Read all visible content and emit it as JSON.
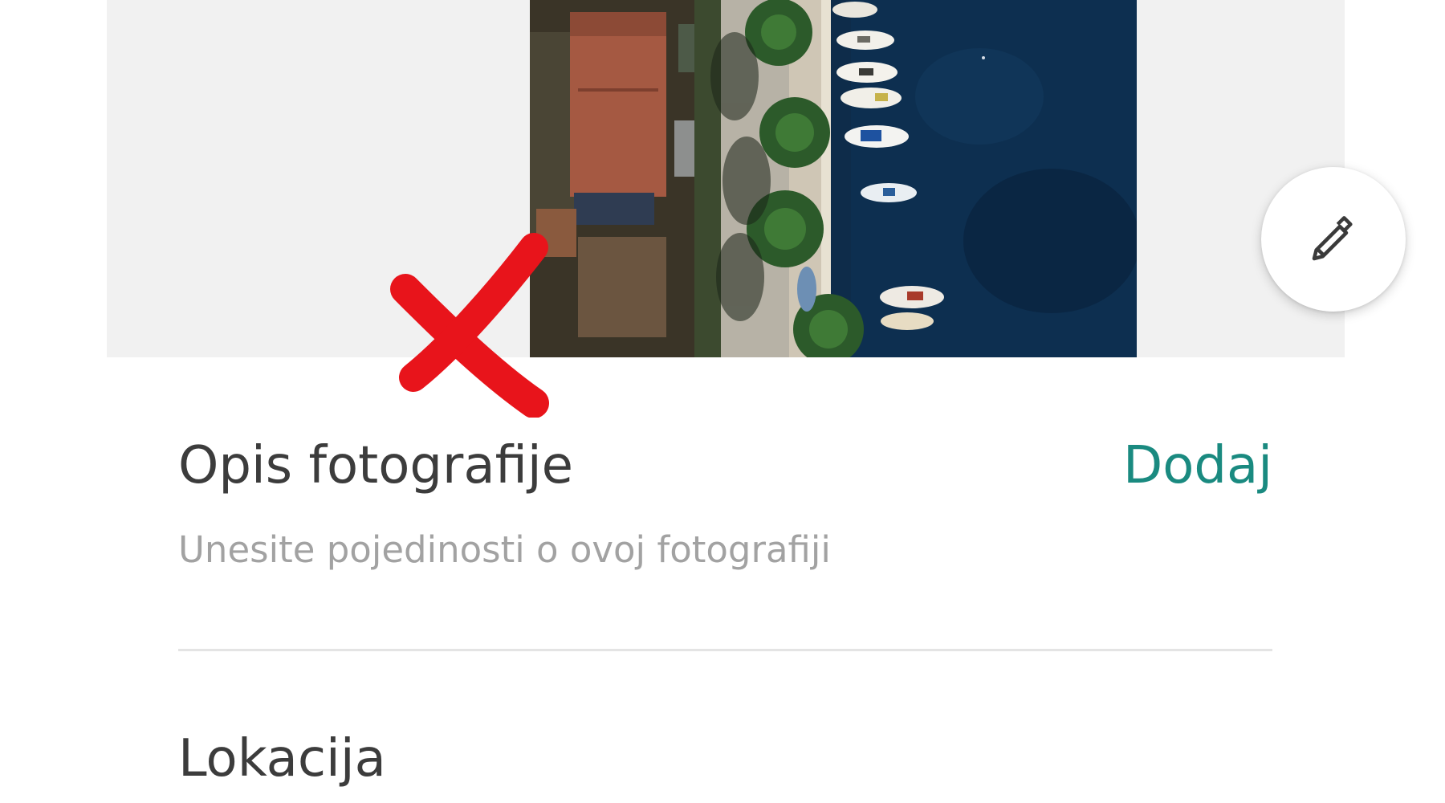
{
  "photo": {
    "description_title": "Opis fotografije",
    "add_label": "Dodaj",
    "description_placeholder": "Unesite pojedinosti o ovoj fotografiji"
  },
  "location": {
    "title": "Lokacija"
  },
  "icons": {
    "edit": "pencil-icon"
  },
  "colors": {
    "accent": "#1a8a80",
    "annotation_mark": "#e8141b"
  }
}
